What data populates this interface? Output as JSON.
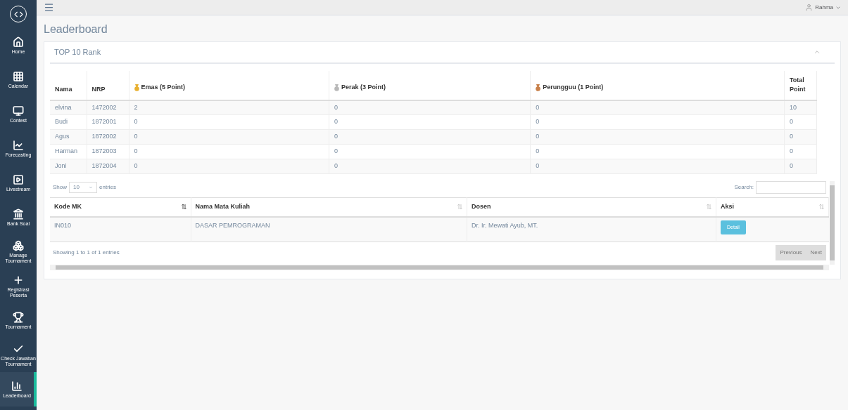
{
  "sidebar": {
    "items": [
      {
        "label": "Home",
        "selected": false
      },
      {
        "label": "Calendar",
        "selected": false
      },
      {
        "label": "Contest",
        "selected": false
      },
      {
        "label": "Forecasting",
        "selected": false
      },
      {
        "label": "Livestream",
        "selected": false
      },
      {
        "label": "Bank Soal",
        "selected": false
      },
      {
        "label": "Manage Tournament",
        "selected": false
      },
      {
        "label": "Registrasi Peserta",
        "selected": false
      },
      {
        "label": "Tournament",
        "selected": false
      },
      {
        "label": "Check Jawaban Tournament",
        "selected": false
      },
      {
        "label": "Leaderboard",
        "selected": true
      }
    ]
  },
  "topbar": {
    "user": "Rahma"
  },
  "page_title": "Leaderboard",
  "panel": {
    "title": "TOP 10 Rank",
    "rank_table": {
      "columns": [
        {
          "label": "Nama"
        },
        {
          "label": "NRP"
        },
        {
          "label": "Emas (5 Point)",
          "color": "#e8b030"
        },
        {
          "label": "Perak (3 Point)",
          "color": "#b8b8b8"
        },
        {
          "label": "Perungguu (1 Point)",
          "color": "#c8804a"
        },
        {
          "label": "Total Point"
        }
      ],
      "rows": [
        [
          "elvina",
          "1472002",
          "2",
          "0",
          "0",
          "10"
        ],
        [
          "Budi",
          "1872001",
          "0",
          "0",
          "0",
          "0"
        ],
        [
          "Agus",
          "1872002",
          "0",
          "0",
          "0",
          "0"
        ],
        [
          "Harman",
          "1872003",
          "0",
          "0",
          "0",
          "0"
        ],
        [
          "Joni",
          "1872004",
          "0",
          "0",
          "0",
          "0"
        ]
      ]
    },
    "course_table": {
      "show_label": "Show",
      "page_size": "10",
      "entries_label": "entries",
      "search_label": "Search:",
      "columns": [
        {
          "label": "Kode MK",
          "sorted": true
        },
        {
          "label": "Nama Mata Kuliah",
          "sorted": false
        },
        {
          "label": "Dosen",
          "sorted": false
        },
        {
          "label": "Aksi",
          "sorted": false
        }
      ],
      "rows": [
        {
          "cells": [
            "IN010",
            "DASAR PEMROGRAMAN",
            "Dr. Ir. Mewati Ayub, MT."
          ],
          "button": "Detail"
        }
      ],
      "info": "Showing 1 to 1 of 1 entries",
      "previous": "Previous",
      "next": "Next"
    }
  }
}
